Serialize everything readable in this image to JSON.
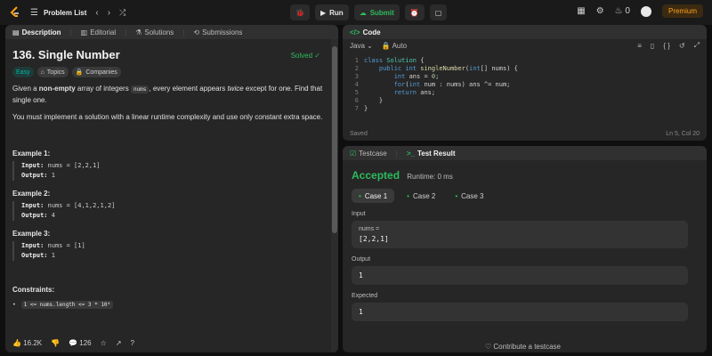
{
  "topbar": {
    "problem_list": "Problem List",
    "run": "Run",
    "submit": "Submit",
    "streak": "0",
    "premium": "Premium"
  },
  "description": {
    "tabs": [
      "Description",
      "Editorial",
      "Solutions",
      "Submissions"
    ],
    "title": "136. Single Number",
    "status": "Solved",
    "tags": [
      "Easy",
      "Topics",
      "Companies"
    ],
    "para1_before": "Given a ",
    "para1_bold": "non-empty",
    "para1_mid": " array of integers ",
    "para1_code": "nums",
    "para1_after": ", every element appears ",
    "para1_italic": "twice",
    "para1_end": " except for one. Find that single one.",
    "para2": "You must implement a solution with a linear runtime complexity and use only constant extra space.",
    "examples": [
      {
        "title": "Example 1:",
        "input": "nums = [2,2,1]",
        "output": "1"
      },
      {
        "title": "Example 2:",
        "input": "nums = [4,1,2,1,2]",
        "output": "4"
      },
      {
        "title": "Example 3:",
        "input": "nums = [1]",
        "output": "1"
      }
    ],
    "input_label": "Input:",
    "output_label": "Output:",
    "constraints_title": "Constraints:",
    "constraint_1": "1 <= nums.length <= 3 * 10⁴",
    "likes": "16.2K",
    "comments": "126"
  },
  "code": {
    "header": "Code",
    "language": "Java",
    "mode": "Auto",
    "saved": "Saved",
    "cursor": "Ln 5, Col 20"
  },
  "result": {
    "tabs": [
      "Testcase",
      "Test Result"
    ],
    "status": "Accepted",
    "runtime": "Runtime: 0 ms",
    "cases": [
      "Case 1",
      "Case 2",
      "Case 3"
    ],
    "input_label": "Input",
    "input_var": "nums =",
    "input_value": "[2,2,1]",
    "output_label": "Output",
    "output_value": "1",
    "expected_label": "Expected",
    "expected_value": "1",
    "contribute": "Contribute a testcase"
  }
}
